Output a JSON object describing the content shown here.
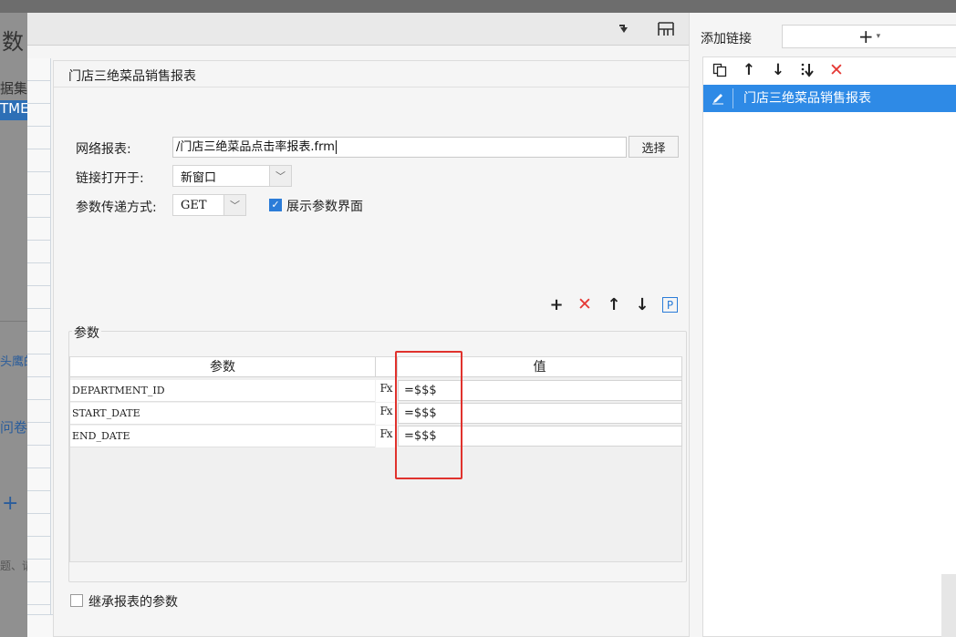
{
  "background": {
    "fragments": [
      "数",
      "据集",
      "TME",
      "头鹰的",
      "问卷",
      "+",
      "题、请"
    ]
  },
  "toolbar": {
    "icon_a": "pin-icon",
    "icon_b": "layout-icon"
  },
  "panel": {
    "title": "门店三绝菜品销售报表",
    "web_report_label": "网络报表:",
    "web_report_value": "/门店三绝菜品点击率报表.frm",
    "choose_button": "选择",
    "open_in_label": "链接打开于:",
    "open_in_value": "新窗口",
    "param_method_label": "参数传递方式:",
    "param_method_value": "GET",
    "show_params_label": "展示参数界面",
    "show_params_checked": true,
    "params_title": "参数",
    "inherit_label": "继承报表的参数",
    "inherit_checked": false
  },
  "params_table": {
    "col_param": "参数",
    "col_value": "值",
    "formula_icon": "Fx",
    "rows": [
      {
        "name": "DEPARTMENT_ID",
        "value": "=$$$"
      },
      {
        "name": "START_DATE",
        "value": "=$$$"
      },
      {
        "name": "END_DATE",
        "value": "=$$$"
      }
    ]
  },
  "params_toolbar": {
    "add": "+",
    "delete": "✕",
    "up": "↑",
    "down": "↓",
    "param": "P"
  },
  "right": {
    "add_link_label": "添加链接",
    "add_link_button": "+",
    "add_link_dropdown": "▾",
    "links": [
      {
        "label": "门店三绝菜品销售报表"
      }
    ]
  },
  "colors": {
    "accent": "#2e8ae6",
    "highlight": "#e0322d",
    "delete": "#e53935"
  }
}
